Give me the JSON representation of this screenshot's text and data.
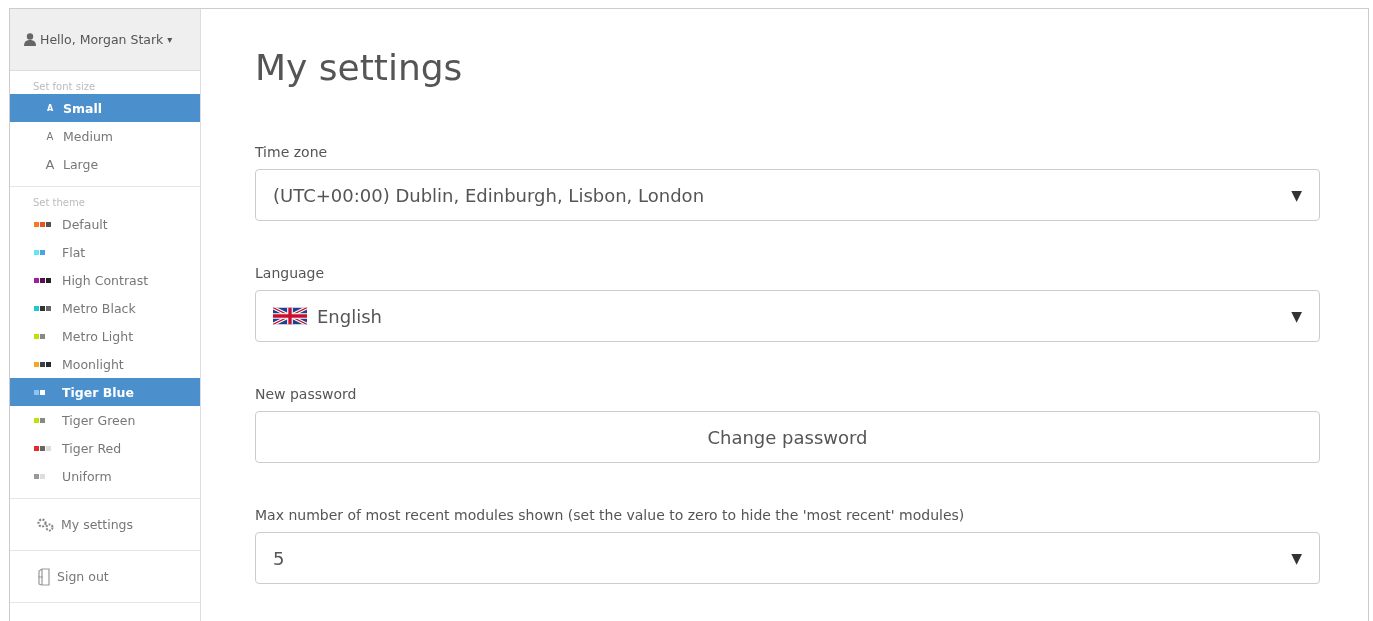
{
  "user_menu": {
    "label": "Hello, Morgan Stark",
    "caret": "▾"
  },
  "font_size": {
    "heading": "Set font size",
    "items": [
      {
        "glyph": "A",
        "label": "Small",
        "kind": "small",
        "selected": true
      },
      {
        "glyph": "A",
        "label": "Medium",
        "kind": "medium",
        "selected": false
      },
      {
        "glyph": "A",
        "label": "Large",
        "kind": "large",
        "selected": false
      }
    ]
  },
  "theme": {
    "heading": "Set theme",
    "items": [
      {
        "label": "Default",
        "selected": false,
        "swatches": [
          {
            "color": "#f47b20"
          },
          {
            "color": "#e8502a"
          },
          {
            "color": "#5a4e48"
          }
        ]
      },
      {
        "label": "Flat",
        "selected": false,
        "swatches": [
          {
            "color": "#5ee8f5"
          },
          {
            "color": "#4aa3e8"
          }
        ]
      },
      {
        "label": "High Contrast",
        "selected": false,
        "swatches": [
          {
            "color": "#a0209a"
          },
          {
            "color": "#5a0f50"
          },
          {
            "color": "#222222"
          }
        ]
      },
      {
        "label": "Metro Black",
        "selected": false,
        "swatches": [
          {
            "color": "#19c9d6"
          },
          {
            "color": "#333333"
          },
          {
            "color": "#666666"
          }
        ]
      },
      {
        "label": "Metro Light",
        "selected": false,
        "swatches": [
          {
            "color": "#b8e600"
          },
          {
            "color": "#888888"
          }
        ]
      },
      {
        "label": "Moonlight",
        "selected": false,
        "swatches": [
          {
            "color": "#f5a623"
          },
          {
            "color": "#3a3f48"
          },
          {
            "color": "#252a33"
          }
        ]
      },
      {
        "label": "Tiger Blue",
        "selected": true,
        "swatches": [
          {
            "color": "#8ec3ef"
          },
          {
            "color": "#ffffff"
          }
        ]
      },
      {
        "label": "Tiger Green",
        "selected": false,
        "swatches": [
          {
            "color": "#b8e600"
          },
          {
            "color": "#888888"
          }
        ]
      },
      {
        "label": "Tiger Red",
        "selected": false,
        "swatches": [
          {
            "color": "#e8282a"
          },
          {
            "color": "#666666"
          },
          {
            "color": "#dddddd"
          }
        ]
      },
      {
        "label": "Uniform",
        "selected": false,
        "swatches": [
          {
            "color": "#999999"
          },
          {
            "color": "#dddddd"
          }
        ]
      }
    ]
  },
  "links": [
    {
      "label": "My settings",
      "kind": "settings"
    },
    {
      "label": "Sign out",
      "kind": "signout"
    }
  ],
  "page_title": "My settings",
  "fields": [
    {
      "label": "Time zone",
      "kind": "select",
      "value": "(UTC+00:00) Dublin, Edinburgh, Lisbon, London",
      "arrow": "▼"
    },
    {
      "label": "Language",
      "kind": "select",
      "flag": true,
      "value": "English",
      "arrow": "▼"
    },
    {
      "label": "New password",
      "kind": "button",
      "value": "Change password"
    },
    {
      "label": "Max number of most recent modules shown (set the value to zero to hide the 'most recent' modules)",
      "kind": "select",
      "value": "5",
      "arrow": "▼"
    }
  ]
}
